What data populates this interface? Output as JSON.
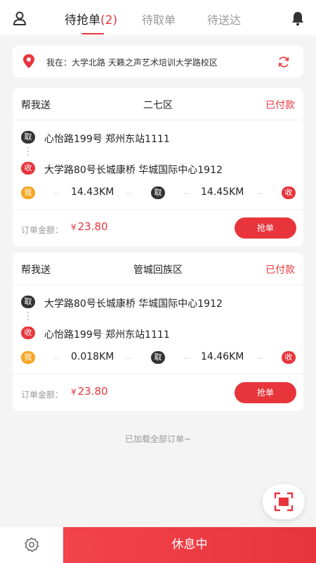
{
  "colors": {
    "accent": "#e8353c",
    "dark_badge": "#333333",
    "me_badge": "#f7a41f",
    "background": "#f4f4f4"
  },
  "header": {
    "icons": {
      "left": "user-icon",
      "right": "bell-icon"
    },
    "tabs": [
      {
        "label": "待抢单",
        "count": "(2)"
      },
      {
        "label": "待取单"
      },
      {
        "label": "待送达"
      }
    ]
  },
  "location": {
    "icon": "location-pin-icon",
    "text": "我在：大学北路 天籁之声艺术培训大学路校区",
    "refresh_icon": "refresh-icon"
  },
  "badges": {
    "pickup": "取",
    "deliver": "收",
    "me": "我"
  },
  "orders": [
    {
      "type": "帮我送",
      "area": "二七区",
      "status": "已付款",
      "first": {
        "badge": "取",
        "address": "心怡路199号 郑州东站1111"
      },
      "second": {
        "badge": "收",
        "address": "大学路80号长城康桥 华城国际中心1912"
      },
      "dist_me_to_pickup": "14.43KM",
      "dist_pickup_to_deliver": "14.45KM",
      "amount_label": "订单金额：",
      "currency": "¥",
      "amount": "23.80",
      "button": "抢单"
    },
    {
      "type": "帮我送",
      "area": "管城回族区",
      "status": "已付款",
      "first": {
        "badge": "取",
        "address": "大学路80号长城康桥 华城国际中心1912"
      },
      "second": {
        "badge": "收",
        "address": "心怡路199号 郑州东站1111"
      },
      "dist_me_to_pickup": "0.018KM",
      "dist_pickup_to_deliver": "14.46KM",
      "amount_label": "订单金额：",
      "currency": "¥",
      "amount": "23.80",
      "button": "抢单"
    }
  ],
  "dash": "--",
  "footer_note": "已加载全部订单~",
  "scan": {
    "icon": "scan-icon"
  },
  "bottom": {
    "settings_icon": "gear-icon",
    "rest_button": "休息中"
  }
}
